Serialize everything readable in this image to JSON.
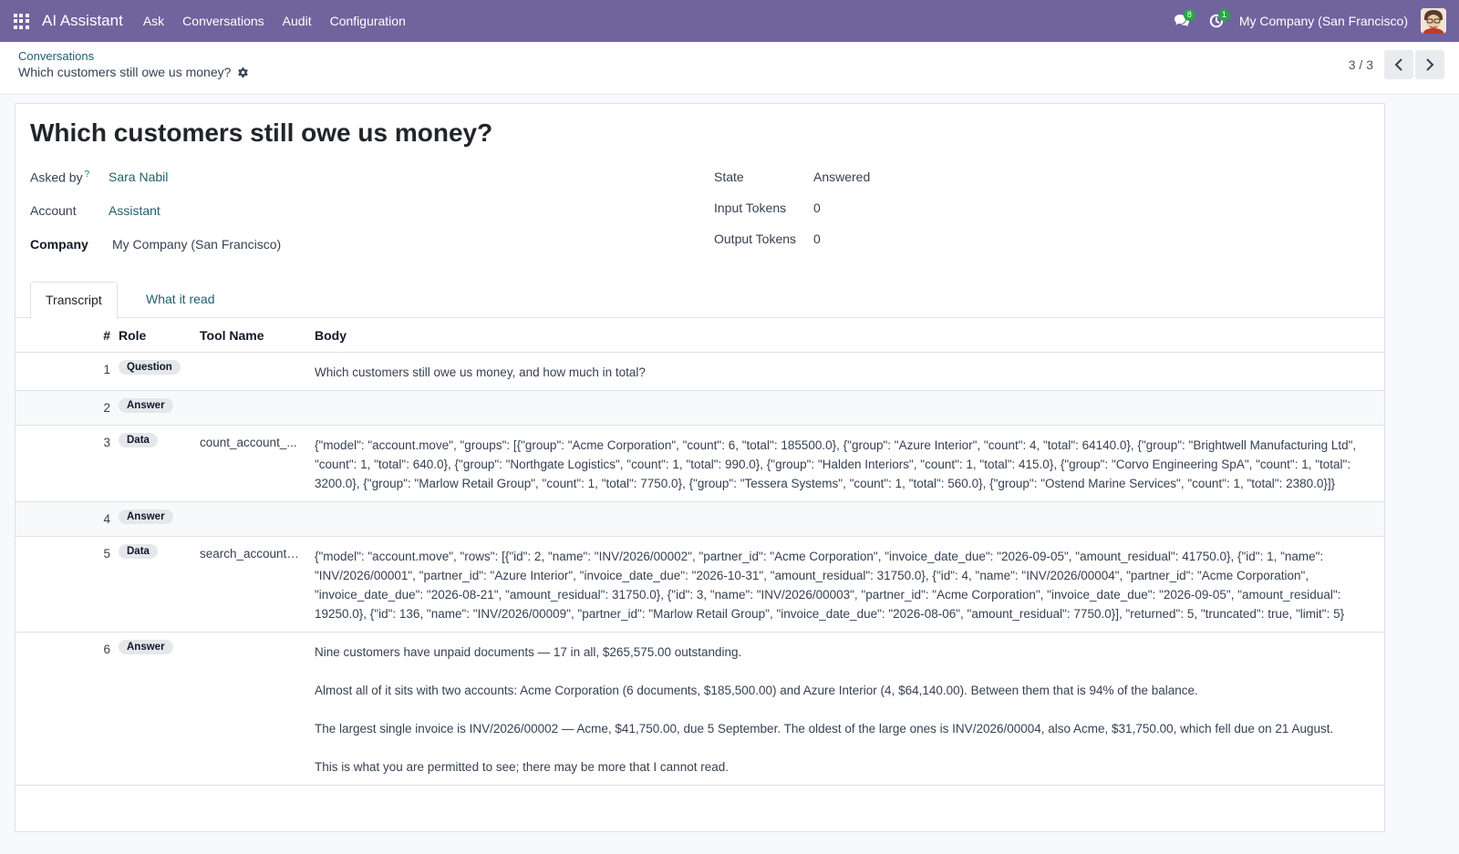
{
  "navbar": {
    "app_name": "AI Assistant",
    "menu": [
      "Ask",
      "Conversations",
      "Audit",
      "Configuration"
    ],
    "messages_count": "8",
    "activities_count": "1",
    "company": "My Company (San Francisco)"
  },
  "breadcrumb": {
    "parent": "Conversations",
    "current": "Which customers still owe us money?"
  },
  "pager": {
    "value": "3 / 3"
  },
  "record": {
    "title": "Which customers still owe us money?",
    "fields": {
      "asked_by_label": "Asked by",
      "asked_by_help": "?",
      "asked_by": "Sara Nabil",
      "account_label": "Account",
      "account": "Assistant",
      "company_label": "Company",
      "company": "My Company (San Francisco)",
      "state_label": "State",
      "state": "Answered",
      "input_tokens_label": "Input Tokens",
      "input_tokens": "0",
      "output_tokens_label": "Output Tokens",
      "output_tokens": "0"
    }
  },
  "tabs": [
    "Transcript",
    "What it read"
  ],
  "transcript": {
    "columns": [
      "#",
      "Role",
      "Tool Name",
      "Body"
    ],
    "rows": [
      {
        "num": "1",
        "role": "Question",
        "tool": "",
        "body": [
          "Which customers still owe us money, and how much in total?"
        ]
      },
      {
        "num": "2",
        "role": "Answer",
        "tool": "",
        "body": []
      },
      {
        "num": "3",
        "role": "Data",
        "tool": "count_account_...",
        "body": [
          "{\"model\": \"account.move\", \"groups\": [{\"group\": \"Acme Corporation\", \"count\": 6, \"total\": 185500.0}, {\"group\": \"Azure Interior\", \"count\": 4, \"total\": 64140.0}, {\"group\": \"Brightwell Manufacturing Ltd\", \"count\": 1, \"total\": 640.0}, {\"group\": \"Northgate Logistics\", \"count\": 1, \"total\": 990.0}, {\"group\": \"Halden Interiors\", \"count\": 1, \"total\": 415.0}, {\"group\": \"Corvo Engineering SpA\", \"count\": 1, \"total\": 3200.0}, {\"group\": \"Marlow Retail Group\", \"count\": 1, \"total\": 7750.0}, {\"group\": \"Tessera Systems\", \"count\": 1, \"total\": 560.0}, {\"group\": \"Ostend Marine Services\", \"count\": 1, \"total\": 2380.0}]}"
        ]
      },
      {
        "num": "4",
        "role": "Answer",
        "tool": "",
        "body": []
      },
      {
        "num": "5",
        "role": "Data",
        "tool": "search_account_...",
        "body": [
          "{\"model\": \"account.move\", \"rows\": [{\"id\": 2, \"name\": \"INV/2026/00002\", \"partner_id\": \"Acme Corporation\", \"invoice_date_due\": \"2026-09-05\", \"amount_residual\": 41750.0}, {\"id\": 1, \"name\": \"INV/2026/00001\", \"partner_id\": \"Azure Interior\", \"invoice_date_due\": \"2026-10-31\", \"amount_residual\": 31750.0}, {\"id\": 4, \"name\": \"INV/2026/00004\", \"partner_id\": \"Acme Corporation\", \"invoice_date_due\": \"2026-08-21\", \"amount_residual\": 31750.0}, {\"id\": 3, \"name\": \"INV/2026/00003\", \"partner_id\": \"Acme Corporation\", \"invoice_date_due\": \"2026-09-05\", \"amount_residual\": 19250.0}, {\"id\": 136, \"name\": \"INV/2026/00009\", \"partner_id\": \"Marlow Retail Group\", \"invoice_date_due\": \"2026-08-06\", \"amount_residual\": 7750.0}], \"returned\": 5, \"truncated\": true, \"limit\": 5}"
        ]
      },
      {
        "num": "6",
        "role": "Answer",
        "tool": "",
        "body": [
          "Nine customers have unpaid documents — 17 in all, $265,575.00 outstanding.",
          "Almost all of it sits with two accounts: Acme Corporation (6 documents, $185,500.00) and Azure Interior (4, $64,140.00). Between them that is 94% of the balance.",
          "The largest single invoice is INV/2026/00002 — Acme, $41,750.00, due 5 September. The oldest of the large ones is INV/2026/00004, also Acme, $31,750.00, which fell due on 21 August.",
          "This is what you are permitted to see; there may be more that I cannot read."
        ]
      }
    ]
  },
  "colors": {
    "navbar": "#71639e",
    "link": "#1f5f6e",
    "badge": "#28a745"
  }
}
